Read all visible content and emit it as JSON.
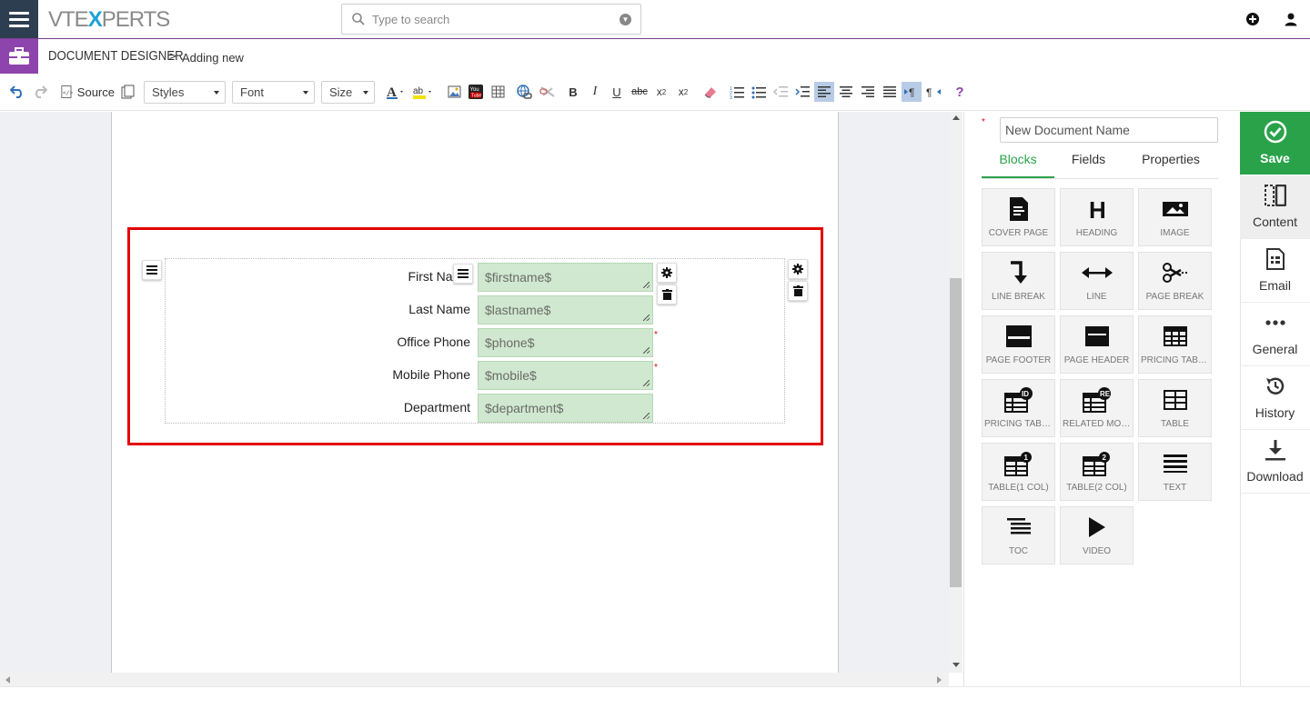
{
  "app": {
    "logo_left": "VTE",
    "logo_x": "X",
    "logo_right": "PERTS"
  },
  "search": {
    "placeholder": "Type to search"
  },
  "header": {
    "module_title": "DOCUMENT DESIGNER",
    "breadcrumb_sep": ">",
    "breadcrumb_current": "Adding new"
  },
  "toolbar": {
    "source_label": "Source",
    "styles_label": "Styles",
    "font_label": "Font",
    "size_label": "Size",
    "help_label": "?"
  },
  "form": {
    "rows": [
      {
        "label": "First Name",
        "value": "$firstname$",
        "required": false
      },
      {
        "label": "Last Name",
        "value": "$lastname$",
        "required": false
      },
      {
        "label": "Office Phone",
        "value": "$phone$",
        "required": true
      },
      {
        "label": "Mobile Phone",
        "value": "$mobile$",
        "required": true
      },
      {
        "label": "Department",
        "value": "$department$",
        "required": false
      }
    ],
    "required_mark": "*"
  },
  "panel": {
    "doc_name_placeholder": "New Document Name",
    "tabs": [
      "Blocks",
      "Fields",
      "Properties"
    ],
    "active_tab": "Blocks",
    "blocks": [
      {
        "label": "COVER PAGE",
        "icon": "cover-page-icon"
      },
      {
        "label": "HEADING",
        "icon": "heading-icon"
      },
      {
        "label": "IMAGE",
        "icon": "image-icon"
      },
      {
        "label": "LINE BREAK",
        "icon": "line-break-icon"
      },
      {
        "label": "LINE",
        "icon": "line-icon"
      },
      {
        "label": "PAGE BREAK",
        "icon": "page-break-icon"
      },
      {
        "label": "PAGE FOOTER",
        "icon": "page-footer-icon"
      },
      {
        "label": "PAGE HEADER",
        "icon": "page-header-icon"
      },
      {
        "label": "PRICING TABLE",
        "icon": "pricing-table-icon"
      },
      {
        "label": "PRICING TABLE",
        "icon": "pricing-table-id-icon"
      },
      {
        "label": "RELATED MODULES",
        "icon": "related-modules-icon"
      },
      {
        "label": "TABLE",
        "icon": "table-icon"
      },
      {
        "label": "TABLE(1 COL)",
        "icon": "table-1-col-icon"
      },
      {
        "label": "TABLE(2 COL)",
        "icon": "table-2-col-icon"
      },
      {
        "label": "TEXT",
        "icon": "text-icon"
      },
      {
        "label": "TOC",
        "icon": "toc-icon"
      },
      {
        "label": "VIDEO",
        "icon": "video-icon"
      }
    ]
  },
  "sidenav": {
    "save_label": "Save",
    "items": [
      {
        "label": "Content",
        "icon": "content-icon",
        "active": true
      },
      {
        "label": "Email",
        "icon": "email-icon",
        "active": false
      },
      {
        "label": "General",
        "icon": "general-icon",
        "active": false
      },
      {
        "label": "History",
        "icon": "history-icon",
        "active": false
      },
      {
        "label": "Download",
        "icon": "download-icon",
        "active": false
      }
    ]
  },
  "colors": {
    "accent_green": "#2aa24a",
    "module_purple": "#8e44ad",
    "highlight_red": "#e30000",
    "field_green": "#cfe8cf"
  }
}
